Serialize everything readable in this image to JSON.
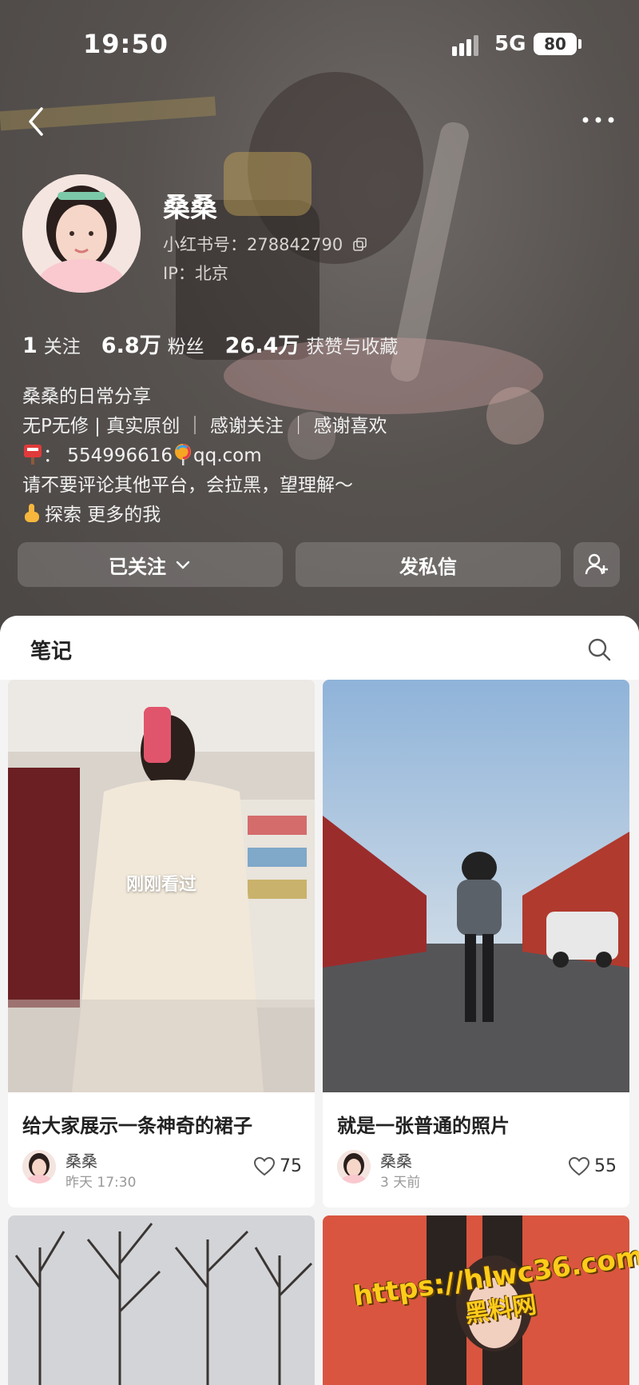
{
  "status": {
    "time": "19:50",
    "network": "5G",
    "battery": "80"
  },
  "profile": {
    "name": "桑桑",
    "red_id": "小红书号：278842790",
    "ip": "IP：北京"
  },
  "stats": [
    {
      "num": "1",
      "label": "关注"
    },
    {
      "num": "6.8万",
      "label": "粉丝"
    },
    {
      "num": "26.4万",
      "label": "获赞与收藏"
    }
  ],
  "bio": {
    "line1": "桑桑的日常分享",
    "line2": "无P无修 | 真实原创 ｜ 感谢关注 ｜ 感谢喜欢",
    "line3_text": "：  554996616",
    "line3_domain": "qq.com",
    "line4": "请不要评论其他平台，会拉黑，望理解～",
    "line5": "探索 更多的我"
  },
  "buttons": {
    "follow": "已关注",
    "message": "发私信"
  },
  "notes": {
    "tab": "笔记",
    "cards": [
      {
        "title": "给大家展示一条神奇的裙子",
        "author": "桑桑",
        "time": "昨天 17:30",
        "likes": "75",
        "overlay": "刚刚看过"
      },
      {
        "title": "就是一张普通的照片",
        "author": "桑桑",
        "time": "3 天前",
        "likes": "55"
      }
    ]
  },
  "watermark": {
    "url": "https://hlwc36.com",
    "name": "黑料网"
  },
  "colors": {
    "accent": "#ff2442",
    "watermark": "#ffcc1a"
  },
  "icons": [
    "back-arrow-icon",
    "more-icon",
    "copy-icon",
    "chevron-down-icon",
    "add-friend-icon",
    "search-icon",
    "heart-icon",
    "mailbox-icon",
    "lollipop-icon",
    "pointing-down-icon"
  ]
}
